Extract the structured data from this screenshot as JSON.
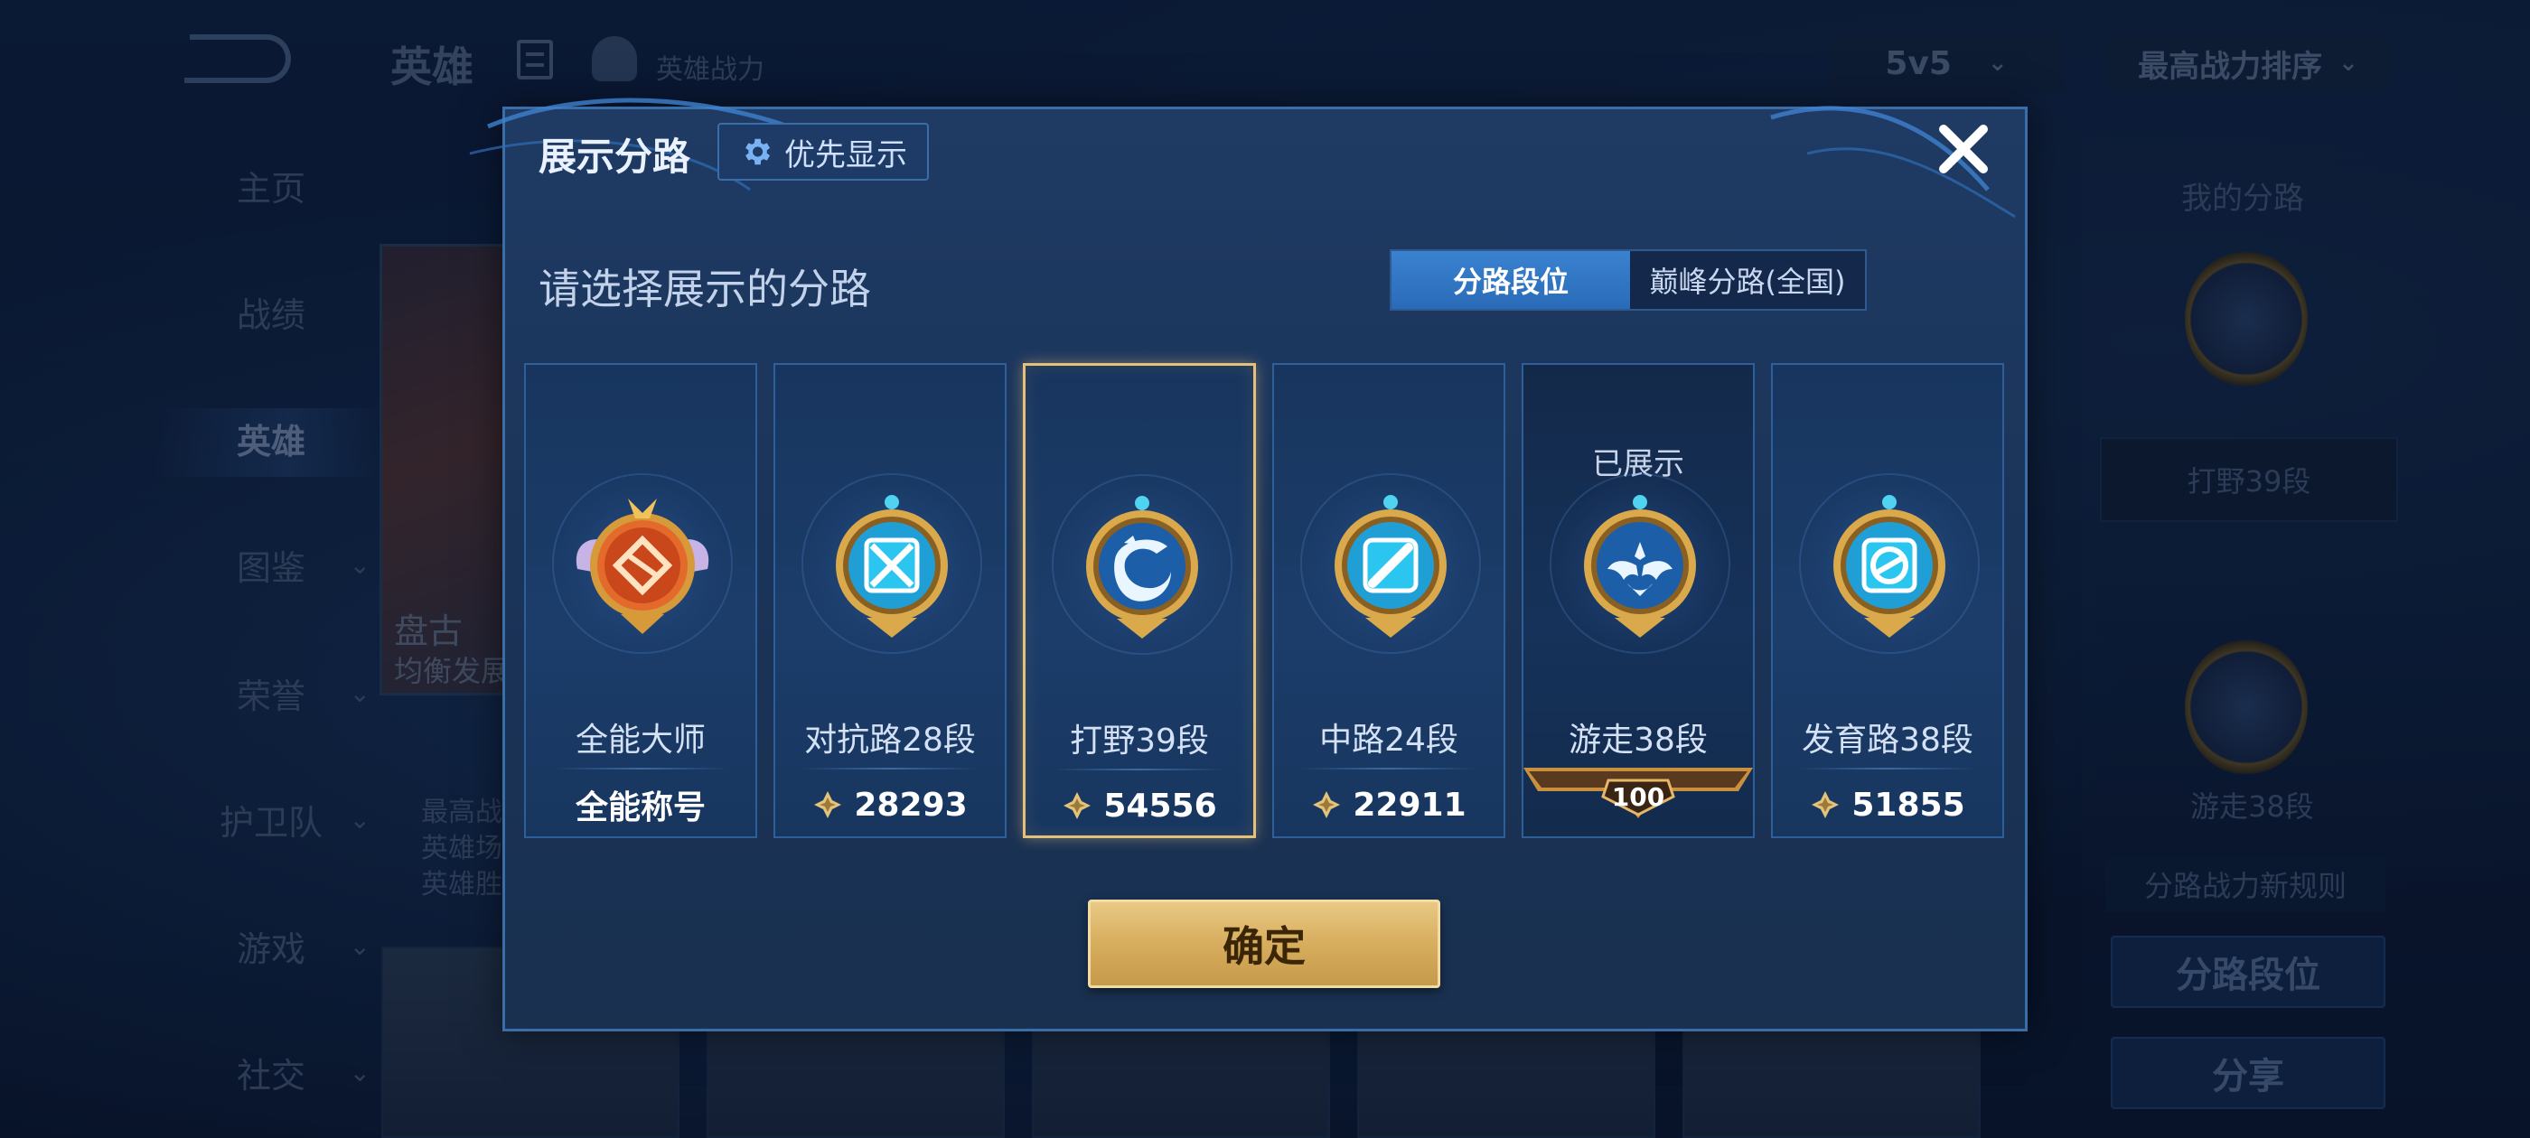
{
  "background": {
    "top_title": "英雄",
    "power_label": "英雄战力",
    "mode_select": "5v5",
    "sort_select": "最高战力排序",
    "nav_items": [
      {
        "label": "主页"
      },
      {
        "label": "战绩"
      },
      {
        "label": "英雄"
      },
      {
        "label": "图鉴"
      },
      {
        "label": "荣誉"
      },
      {
        "label": "护卫队"
      },
      {
        "label": "游戏"
      },
      {
        "label": "社交"
      }
    ],
    "hero_name": "盘古",
    "hero_sub": "均衡发展",
    "hero_stats": [
      "最高战",
      "英雄场",
      "英雄胜"
    ],
    "right_panel": {
      "title": "我的分路",
      "slot1_label": "打野39段",
      "slot2_label": "游走38段",
      "rule_link": "分路战力新规则",
      "lane_rank_button": "分路段位",
      "share_button": "分享"
    }
  },
  "modal": {
    "title": "展示分路",
    "priority_button": "优先显示",
    "subtitle": "请选择展示的分路",
    "tabs": [
      {
        "label": "分路段位",
        "active": true
      },
      {
        "label": "巅峰分路(全国)",
        "active": false
      }
    ],
    "lanes": [
      {
        "name": "全能大师",
        "bottom": "全能称号",
        "kind": "title",
        "icon": "all-round-master-emblem-icon"
      },
      {
        "name": "对抗路28段",
        "bottom": "28293",
        "kind": "power",
        "icon": "clash-lane-emblem-icon"
      },
      {
        "name": "打野39段",
        "bottom": "54556",
        "kind": "power",
        "icon": "jungle-emblem-icon",
        "selected": true
      },
      {
        "name": "中路24段",
        "bottom": "22911",
        "kind": "power",
        "icon": "mid-lane-emblem-icon"
      },
      {
        "name": "游走38段",
        "bottom": "100",
        "kind": "peak",
        "icon": "roam-emblem-icon",
        "status": "已展示"
      },
      {
        "name": "发育路38段",
        "bottom": "51855",
        "kind": "power",
        "icon": "farm-lane-emblem-icon"
      }
    ],
    "confirm_button": "确定"
  },
  "colors": {
    "accent_blue": "#2a6bb8",
    "gold": "#d7ad5e",
    "selected_border": "#e6c07a"
  }
}
